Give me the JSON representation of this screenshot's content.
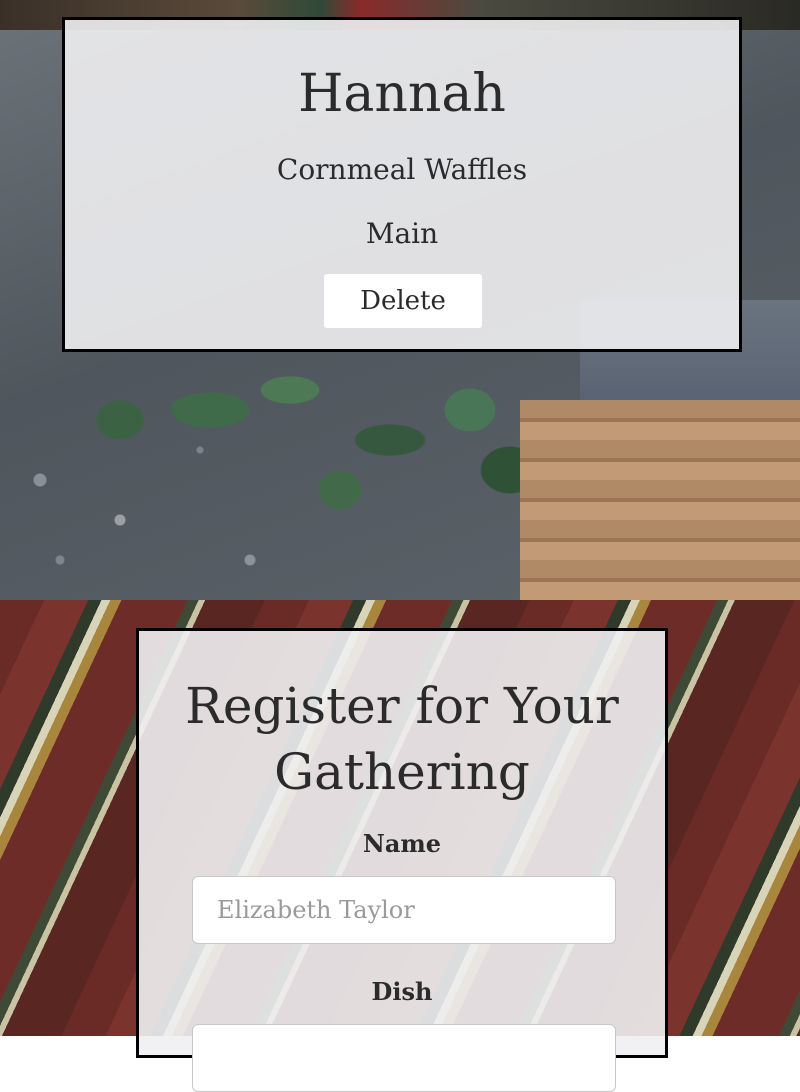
{
  "entry": {
    "name": "Hannah",
    "dish": "Cornmeal Waffles",
    "course": "Main",
    "delete_label": "Delete"
  },
  "register": {
    "title": "Register for Your Gathering",
    "name_label": "Name",
    "name_placeholder": "Elizabeth Taylor",
    "dish_label": "Dish"
  }
}
